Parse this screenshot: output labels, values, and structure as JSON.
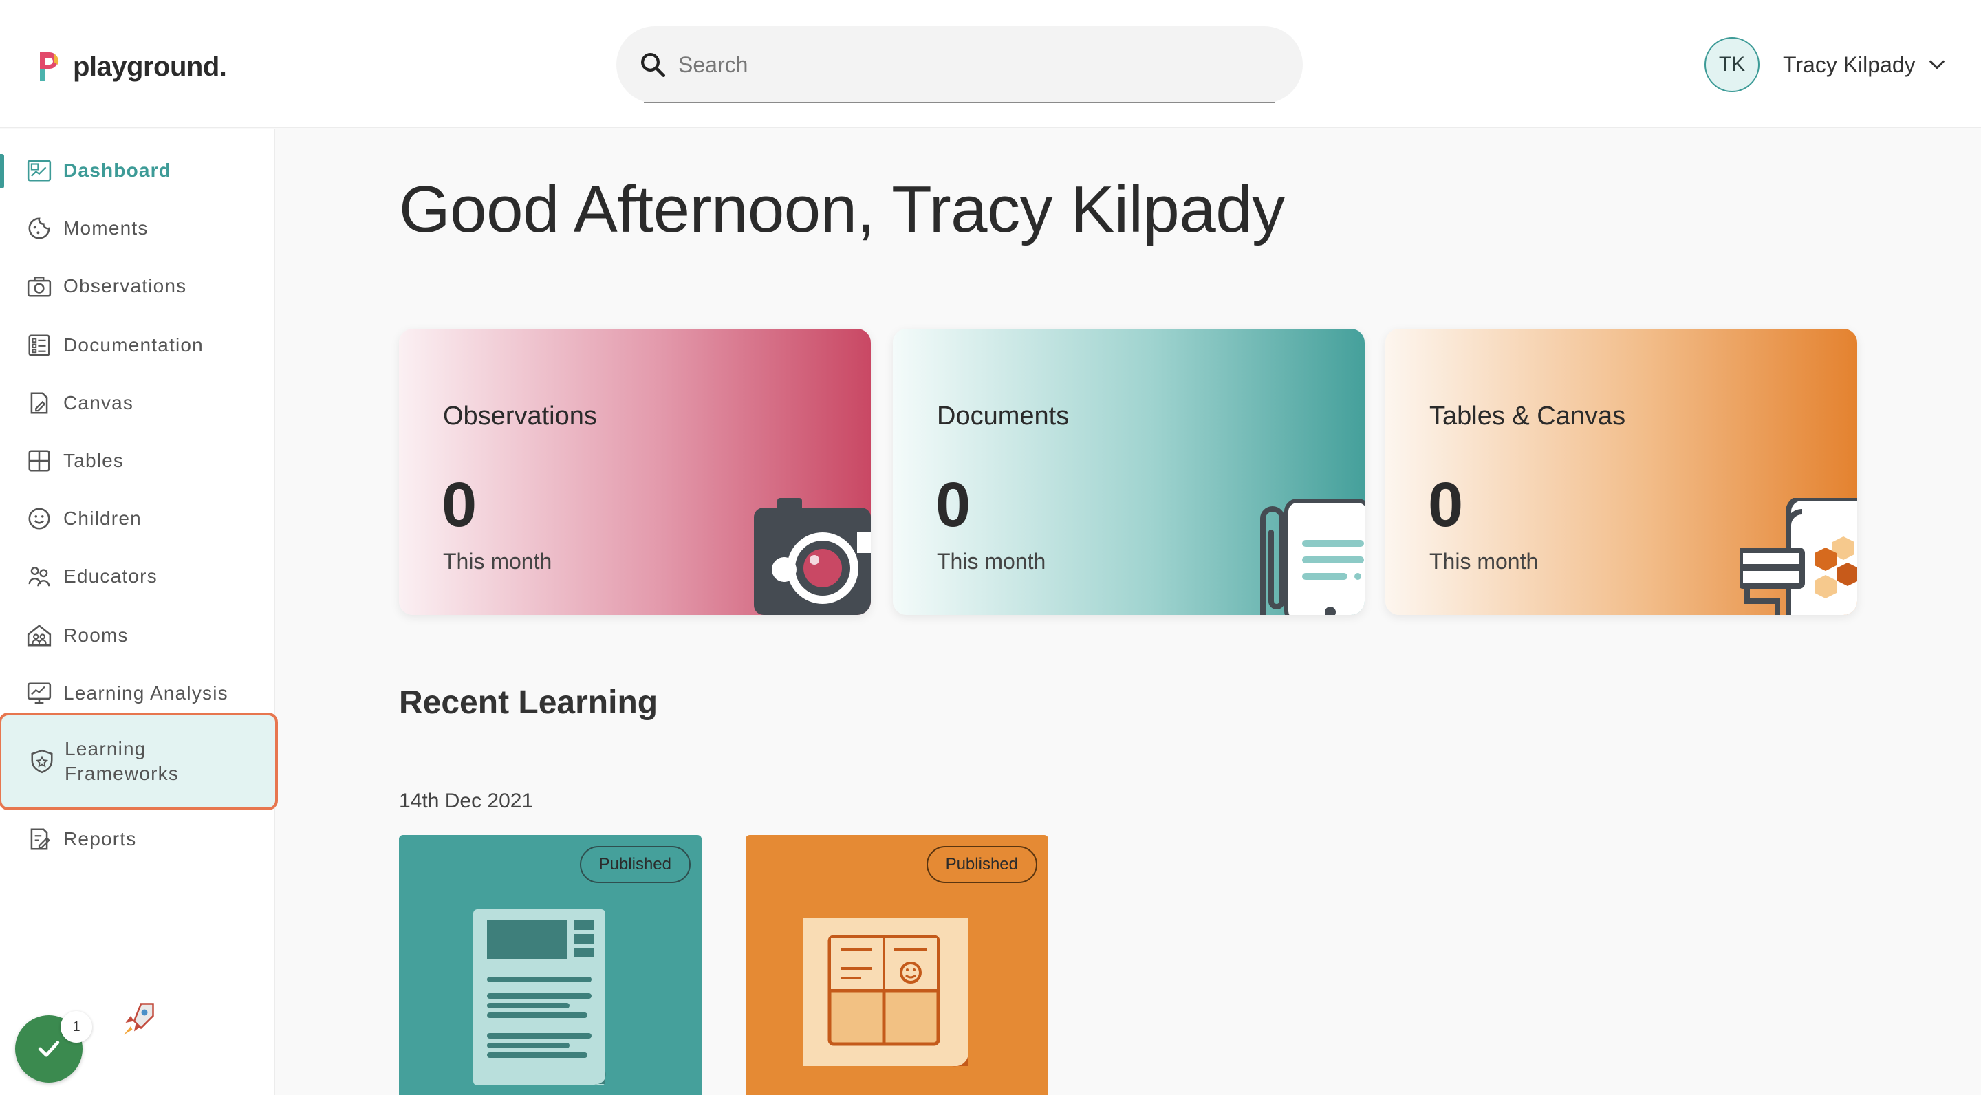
{
  "header": {
    "logo_text": "playground.",
    "search_placeholder": "Search",
    "user_initials": "TK",
    "user_name": "Tracy Kilpady"
  },
  "sidebar": {
    "items": [
      {
        "label": "Dashboard",
        "icon": "dashboard-icon",
        "active": true
      },
      {
        "label": "Moments",
        "icon": "moments-icon"
      },
      {
        "label": "Observations",
        "icon": "camera-icon"
      },
      {
        "label": "Documentation",
        "icon": "document-list-icon"
      },
      {
        "label": "Canvas",
        "icon": "canvas-icon"
      },
      {
        "label": "Tables",
        "icon": "table-icon"
      },
      {
        "label": "Children",
        "icon": "smiley-icon"
      },
      {
        "label": "Educators",
        "icon": "educators-icon"
      },
      {
        "label": "Rooms",
        "icon": "rooms-icon"
      },
      {
        "label": "Learning Analysis",
        "icon": "analysis-icon"
      },
      {
        "label": "Learning",
        "label2": "Frameworks",
        "icon": "framework-shield-icon",
        "highlighted": true
      },
      {
        "label": "Reports",
        "icon": "reports-icon"
      }
    ],
    "fab_badge": "1"
  },
  "main": {
    "greeting": "Good Afternoon, Tracy Kilpady",
    "cards": [
      {
        "title": "Observations",
        "value": "0",
        "sub": "This month",
        "art": "camera-illustration-icon"
      },
      {
        "title": "Documents",
        "value": "0",
        "sub": "This month",
        "art": "document-clip-illustration-icon"
      },
      {
        "title": "Tables & Canvas",
        "value": "0",
        "sub": "This month",
        "art": "canvas-brush-illustration-icon"
      }
    ],
    "recent_title": "Recent Learning",
    "recent_date": "14th Dec 2021",
    "recent_items": [
      {
        "status": "Published",
        "art": "document-illustration-icon",
        "color": "#45a09b"
      },
      {
        "status": "Published",
        "art": "table-illustration-icon",
        "color": "#e58a34"
      }
    ]
  },
  "colors": {
    "accent": "#3d9b97",
    "highlight_border": "#e7764f",
    "observations": "#c94864",
    "documents": "#45a09b",
    "tables": "#e4822f"
  }
}
